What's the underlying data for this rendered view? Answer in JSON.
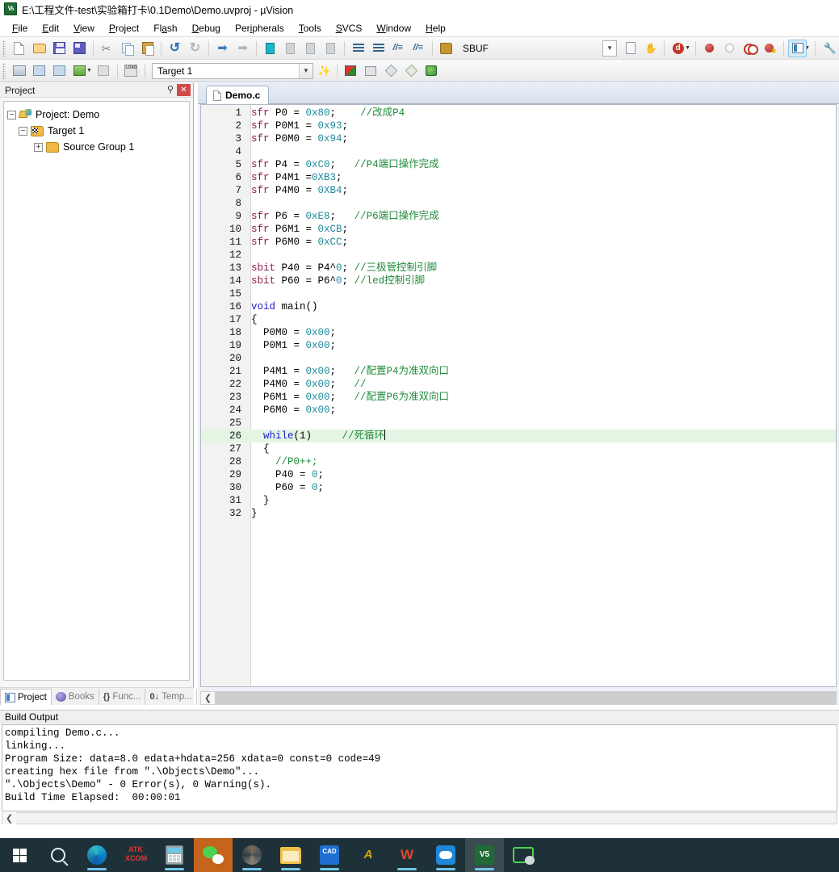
{
  "window": {
    "title": "E:\\工程文件-test\\实验箱打卡\\0.1Demo\\Demo.uvproj - µVision",
    "app_icon": "keil-uvision-icon"
  },
  "menubar": {
    "items": [
      {
        "label": "File",
        "accel": "F"
      },
      {
        "label": "Edit",
        "accel": "E"
      },
      {
        "label": "View",
        "accel": "V"
      },
      {
        "label": "Project",
        "accel": "P"
      },
      {
        "label": "Flash",
        "accel": "a"
      },
      {
        "label": "Debug",
        "accel": "D"
      },
      {
        "label": "Peripherals",
        "accel": "i"
      },
      {
        "label": "Tools",
        "accel": "T"
      },
      {
        "label": "SVCS",
        "accel": "S"
      },
      {
        "label": "Window",
        "accel": "W"
      },
      {
        "label": "Help",
        "accel": "H"
      }
    ]
  },
  "toolbar_main": {
    "buttons": [
      "new-file-icon",
      "open-file-icon",
      "save-icon",
      "save-all-icon",
      "cut-icon",
      "copy-icon",
      "paste-icon",
      "undo-icon",
      "redo-icon",
      "navigate-back-icon",
      "navigate-forward-icon",
      "toggle-bookmark-icon",
      "previous-bookmark-icon",
      "next-bookmark-icon",
      "clear-bookmarks-icon",
      "indent-icon",
      "outdent-icon",
      "comment-icon",
      "uncomment-icon"
    ],
    "find_combo_value": "SBUF",
    "find_combo_label": "find-combo"
  },
  "toolbar_build": {
    "buttons": [
      "translate-icon",
      "build-icon",
      "rebuild-icon",
      "batch-build-icon",
      "stop-build-icon",
      "download-icon"
    ],
    "target_value": "Target 1",
    "after_buttons": [
      "target-options-icon",
      "manage-components-icon",
      "multi-project-icon",
      "configuration-wizard-icon",
      "packs-icon",
      "pack-installer-icon"
    ]
  },
  "project_panel": {
    "caption": "Project",
    "pin_icon": "pin-icon",
    "close_icon": "close-icon",
    "tree": [
      {
        "label": "Project: Demo",
        "level": 0,
        "expander": "-",
        "icon": "project-icon"
      },
      {
        "label": "Target 1",
        "level": 1,
        "expander": "-",
        "icon": "target-icon"
      },
      {
        "label": "Source Group 1",
        "level": 2,
        "expander": "+",
        "icon": "folder-icon"
      }
    ],
    "tabs": [
      {
        "label": "Project",
        "selected": true,
        "icon": "project-tab-icon"
      },
      {
        "label": "Books",
        "selected": false,
        "icon": "books-tab-icon"
      },
      {
        "label": "Func...",
        "selected": false,
        "icon": "functions-tab-icon"
      },
      {
        "label": "Temp...",
        "selected": false,
        "icon": "templates-tab-icon"
      }
    ]
  },
  "editor": {
    "tab_label": "Demo.c",
    "tab_icon": "source-file-icon",
    "highlighted_line": 26,
    "lines": [
      {
        "n": 1,
        "tokens": [
          {
            "t": "sfr",
            "c": "kw"
          },
          {
            "t": " P0 = ",
            "c": "pl"
          },
          {
            "t": "0x80",
            "c": "num"
          },
          {
            "t": ";    ",
            "c": "pl"
          },
          {
            "t": "//改成P4",
            "c": "cm"
          }
        ]
      },
      {
        "n": 2,
        "tokens": [
          {
            "t": "sfr",
            "c": "kw"
          },
          {
            "t": " P0M1 = ",
            "c": "pl"
          },
          {
            "t": "0x93",
            "c": "num"
          },
          {
            "t": ";",
            "c": "pl"
          }
        ]
      },
      {
        "n": 3,
        "tokens": [
          {
            "t": "sfr",
            "c": "kw"
          },
          {
            "t": " P0M0 = ",
            "c": "pl"
          },
          {
            "t": "0x94",
            "c": "num"
          },
          {
            "t": ";",
            "c": "pl"
          }
        ]
      },
      {
        "n": 4,
        "tokens": []
      },
      {
        "n": 5,
        "tokens": [
          {
            "t": "sfr",
            "c": "kw"
          },
          {
            "t": " P4 = ",
            "c": "pl"
          },
          {
            "t": "0xC0",
            "c": "num"
          },
          {
            "t": ";   ",
            "c": "pl"
          },
          {
            "t": "//P4端口操作完成",
            "c": "cm"
          }
        ]
      },
      {
        "n": 6,
        "tokens": [
          {
            "t": "sfr",
            "c": "kw"
          },
          {
            "t": " P4M1 =",
            "c": "pl"
          },
          {
            "t": "0XB3",
            "c": "num"
          },
          {
            "t": ";",
            "c": "pl"
          }
        ]
      },
      {
        "n": 7,
        "tokens": [
          {
            "t": "sfr",
            "c": "kw"
          },
          {
            "t": " P4M0 = ",
            "c": "pl"
          },
          {
            "t": "0XB4",
            "c": "num"
          },
          {
            "t": ";",
            "c": "pl"
          }
        ]
      },
      {
        "n": 8,
        "tokens": []
      },
      {
        "n": 9,
        "tokens": [
          {
            "t": "sfr",
            "c": "kw"
          },
          {
            "t": " P6 = ",
            "c": "pl"
          },
          {
            "t": "0xE8",
            "c": "num"
          },
          {
            "t": ";   ",
            "c": "pl"
          },
          {
            "t": "//P6端口操作完成",
            "c": "cm"
          }
        ]
      },
      {
        "n": 10,
        "tokens": [
          {
            "t": "sfr",
            "c": "kw"
          },
          {
            "t": " P6M1 = ",
            "c": "pl"
          },
          {
            "t": "0xCB",
            "c": "num"
          },
          {
            "t": ";",
            "c": "pl"
          }
        ]
      },
      {
        "n": 11,
        "tokens": [
          {
            "t": "sfr",
            "c": "kw"
          },
          {
            "t": " P6M0 = ",
            "c": "pl"
          },
          {
            "t": "0xCC",
            "c": "num"
          },
          {
            "t": ";",
            "c": "pl"
          }
        ]
      },
      {
        "n": 12,
        "tokens": []
      },
      {
        "n": 13,
        "tokens": [
          {
            "t": "sbit",
            "c": "kw"
          },
          {
            "t": " P40 = P4^",
            "c": "pl"
          },
          {
            "t": "0",
            "c": "num"
          },
          {
            "t": "; ",
            "c": "pl"
          },
          {
            "t": "//三极管控制引脚",
            "c": "cm"
          }
        ]
      },
      {
        "n": 14,
        "tokens": [
          {
            "t": "sbit",
            "c": "kw"
          },
          {
            "t": " P60 = P6^",
            "c": "pl"
          },
          {
            "t": "0",
            "c": "num"
          },
          {
            "t": "; ",
            "c": "pl"
          },
          {
            "t": "//led控制引脚",
            "c": "cm"
          }
        ]
      },
      {
        "n": 15,
        "tokens": []
      },
      {
        "n": 16,
        "tokens": [
          {
            "t": "void",
            "c": "kw2"
          },
          {
            "t": " main()",
            "c": "pl"
          }
        ]
      },
      {
        "n": 17,
        "tokens": [
          {
            "t": "{",
            "c": "pl"
          }
        ]
      },
      {
        "n": 18,
        "tokens": [
          {
            "t": "  P0M0 = ",
            "c": "pl"
          },
          {
            "t": "0x00",
            "c": "num"
          },
          {
            "t": ";",
            "c": "pl"
          }
        ]
      },
      {
        "n": 19,
        "tokens": [
          {
            "t": "  P0M1 = ",
            "c": "pl"
          },
          {
            "t": "0x00",
            "c": "num"
          },
          {
            "t": ";",
            "c": "pl"
          }
        ]
      },
      {
        "n": 20,
        "tokens": []
      },
      {
        "n": 21,
        "tokens": [
          {
            "t": "  P4M1 = ",
            "c": "pl"
          },
          {
            "t": "0x00",
            "c": "num"
          },
          {
            "t": ";   ",
            "c": "pl"
          },
          {
            "t": "//配置P4为准双向口",
            "c": "cm"
          }
        ]
      },
      {
        "n": 22,
        "tokens": [
          {
            "t": "  P4M0 = ",
            "c": "pl"
          },
          {
            "t": "0x00",
            "c": "num"
          },
          {
            "t": ";   ",
            "c": "pl"
          },
          {
            "t": "//",
            "c": "cm"
          }
        ]
      },
      {
        "n": 23,
        "tokens": [
          {
            "t": "  P6M1 = ",
            "c": "pl"
          },
          {
            "t": "0x00",
            "c": "num"
          },
          {
            "t": ";   ",
            "c": "pl"
          },
          {
            "t": "//配置P6为准双向口",
            "c": "cm"
          }
        ]
      },
      {
        "n": 24,
        "tokens": [
          {
            "t": "  P6M0 = ",
            "c": "pl"
          },
          {
            "t": "0x00",
            "c": "num"
          },
          {
            "t": ";",
            "c": "pl"
          }
        ]
      },
      {
        "n": 25,
        "tokens": []
      },
      {
        "n": 26,
        "tokens": [
          {
            "t": "  ",
            "c": "pl"
          },
          {
            "t": "while",
            "c": "kw2"
          },
          {
            "t": "(1)     ",
            "c": "pl"
          },
          {
            "t": "//死循环",
            "c": "cm"
          }
        ]
      },
      {
        "n": 27,
        "tokens": [
          {
            "t": "  {",
            "c": "pl"
          }
        ]
      },
      {
        "n": 28,
        "tokens": [
          {
            "t": "    ",
            "c": "pl"
          },
          {
            "t": "//P0++;",
            "c": "cm"
          }
        ]
      },
      {
        "n": 29,
        "tokens": [
          {
            "t": "    P40 = ",
            "c": "pl"
          },
          {
            "t": "0",
            "c": "num"
          },
          {
            "t": ";",
            "c": "pl"
          }
        ]
      },
      {
        "n": 30,
        "tokens": [
          {
            "t": "    P60 = ",
            "c": "pl"
          },
          {
            "t": "0",
            "c": "num"
          },
          {
            "t": ";",
            "c": "pl"
          }
        ]
      },
      {
        "n": 31,
        "tokens": [
          {
            "t": "  }",
            "c": "pl"
          }
        ]
      },
      {
        "n": 32,
        "tokens": [
          {
            "t": "}",
            "c": "pl"
          }
        ]
      }
    ]
  },
  "build_output": {
    "caption": "Build Output",
    "lines": [
      "compiling Demo.c...",
      "linking...",
      "Program Size: data=8.0 edata+hdata=256 xdata=0 const=0 code=49",
      "creating hex file from \".\\Objects\\Demo\"...",
      "\".\\Objects\\Demo\" - 0 Error(s), 0 Warning(s).",
      "Build Time Elapsed:  00:00:01"
    ]
  },
  "taskbar": {
    "items": [
      {
        "name": "start-button",
        "icon": "windows-logo-icon",
        "running": false
      },
      {
        "name": "search-button",
        "icon": "search-icon",
        "running": false
      },
      {
        "name": "edge-button",
        "icon": "edge-icon",
        "running": true
      },
      {
        "name": "atk-xcom-button",
        "icon": "atk-xcom-icon",
        "running": false
      },
      {
        "name": "calculator-button",
        "icon": "calculator-icon",
        "running": true
      },
      {
        "name": "wechat-button",
        "icon": "wechat-icon",
        "running": true,
        "active": true
      },
      {
        "name": "photos-button",
        "icon": "photos-icon",
        "running": true
      },
      {
        "name": "file-explorer-button",
        "icon": "folder-icon",
        "running": true
      },
      {
        "name": "cad-button",
        "icon": "cad-icon",
        "running": true
      },
      {
        "name": "altium-button",
        "icon": "altium-icon",
        "running": false
      },
      {
        "name": "wps-button",
        "icon": "wps-icon",
        "running": false
      },
      {
        "name": "cloud-button",
        "icon": "cloud-icon",
        "running": true
      },
      {
        "name": "keil-uvision-button",
        "icon": "keil-icon",
        "running": true,
        "active": true
      },
      {
        "name": "wechat-devtool-button",
        "icon": "wechat-outline-icon",
        "running": false
      }
    ]
  },
  "colors": {
    "keyword": "#8b1a4a",
    "keyword_control": "#1a1acc",
    "number": "#1f8a9b",
    "comment": "#1f8b3a",
    "highlight_line": "#e4f5e4",
    "taskbar_bg": "#1f3138",
    "accent": "#c4651b"
  }
}
